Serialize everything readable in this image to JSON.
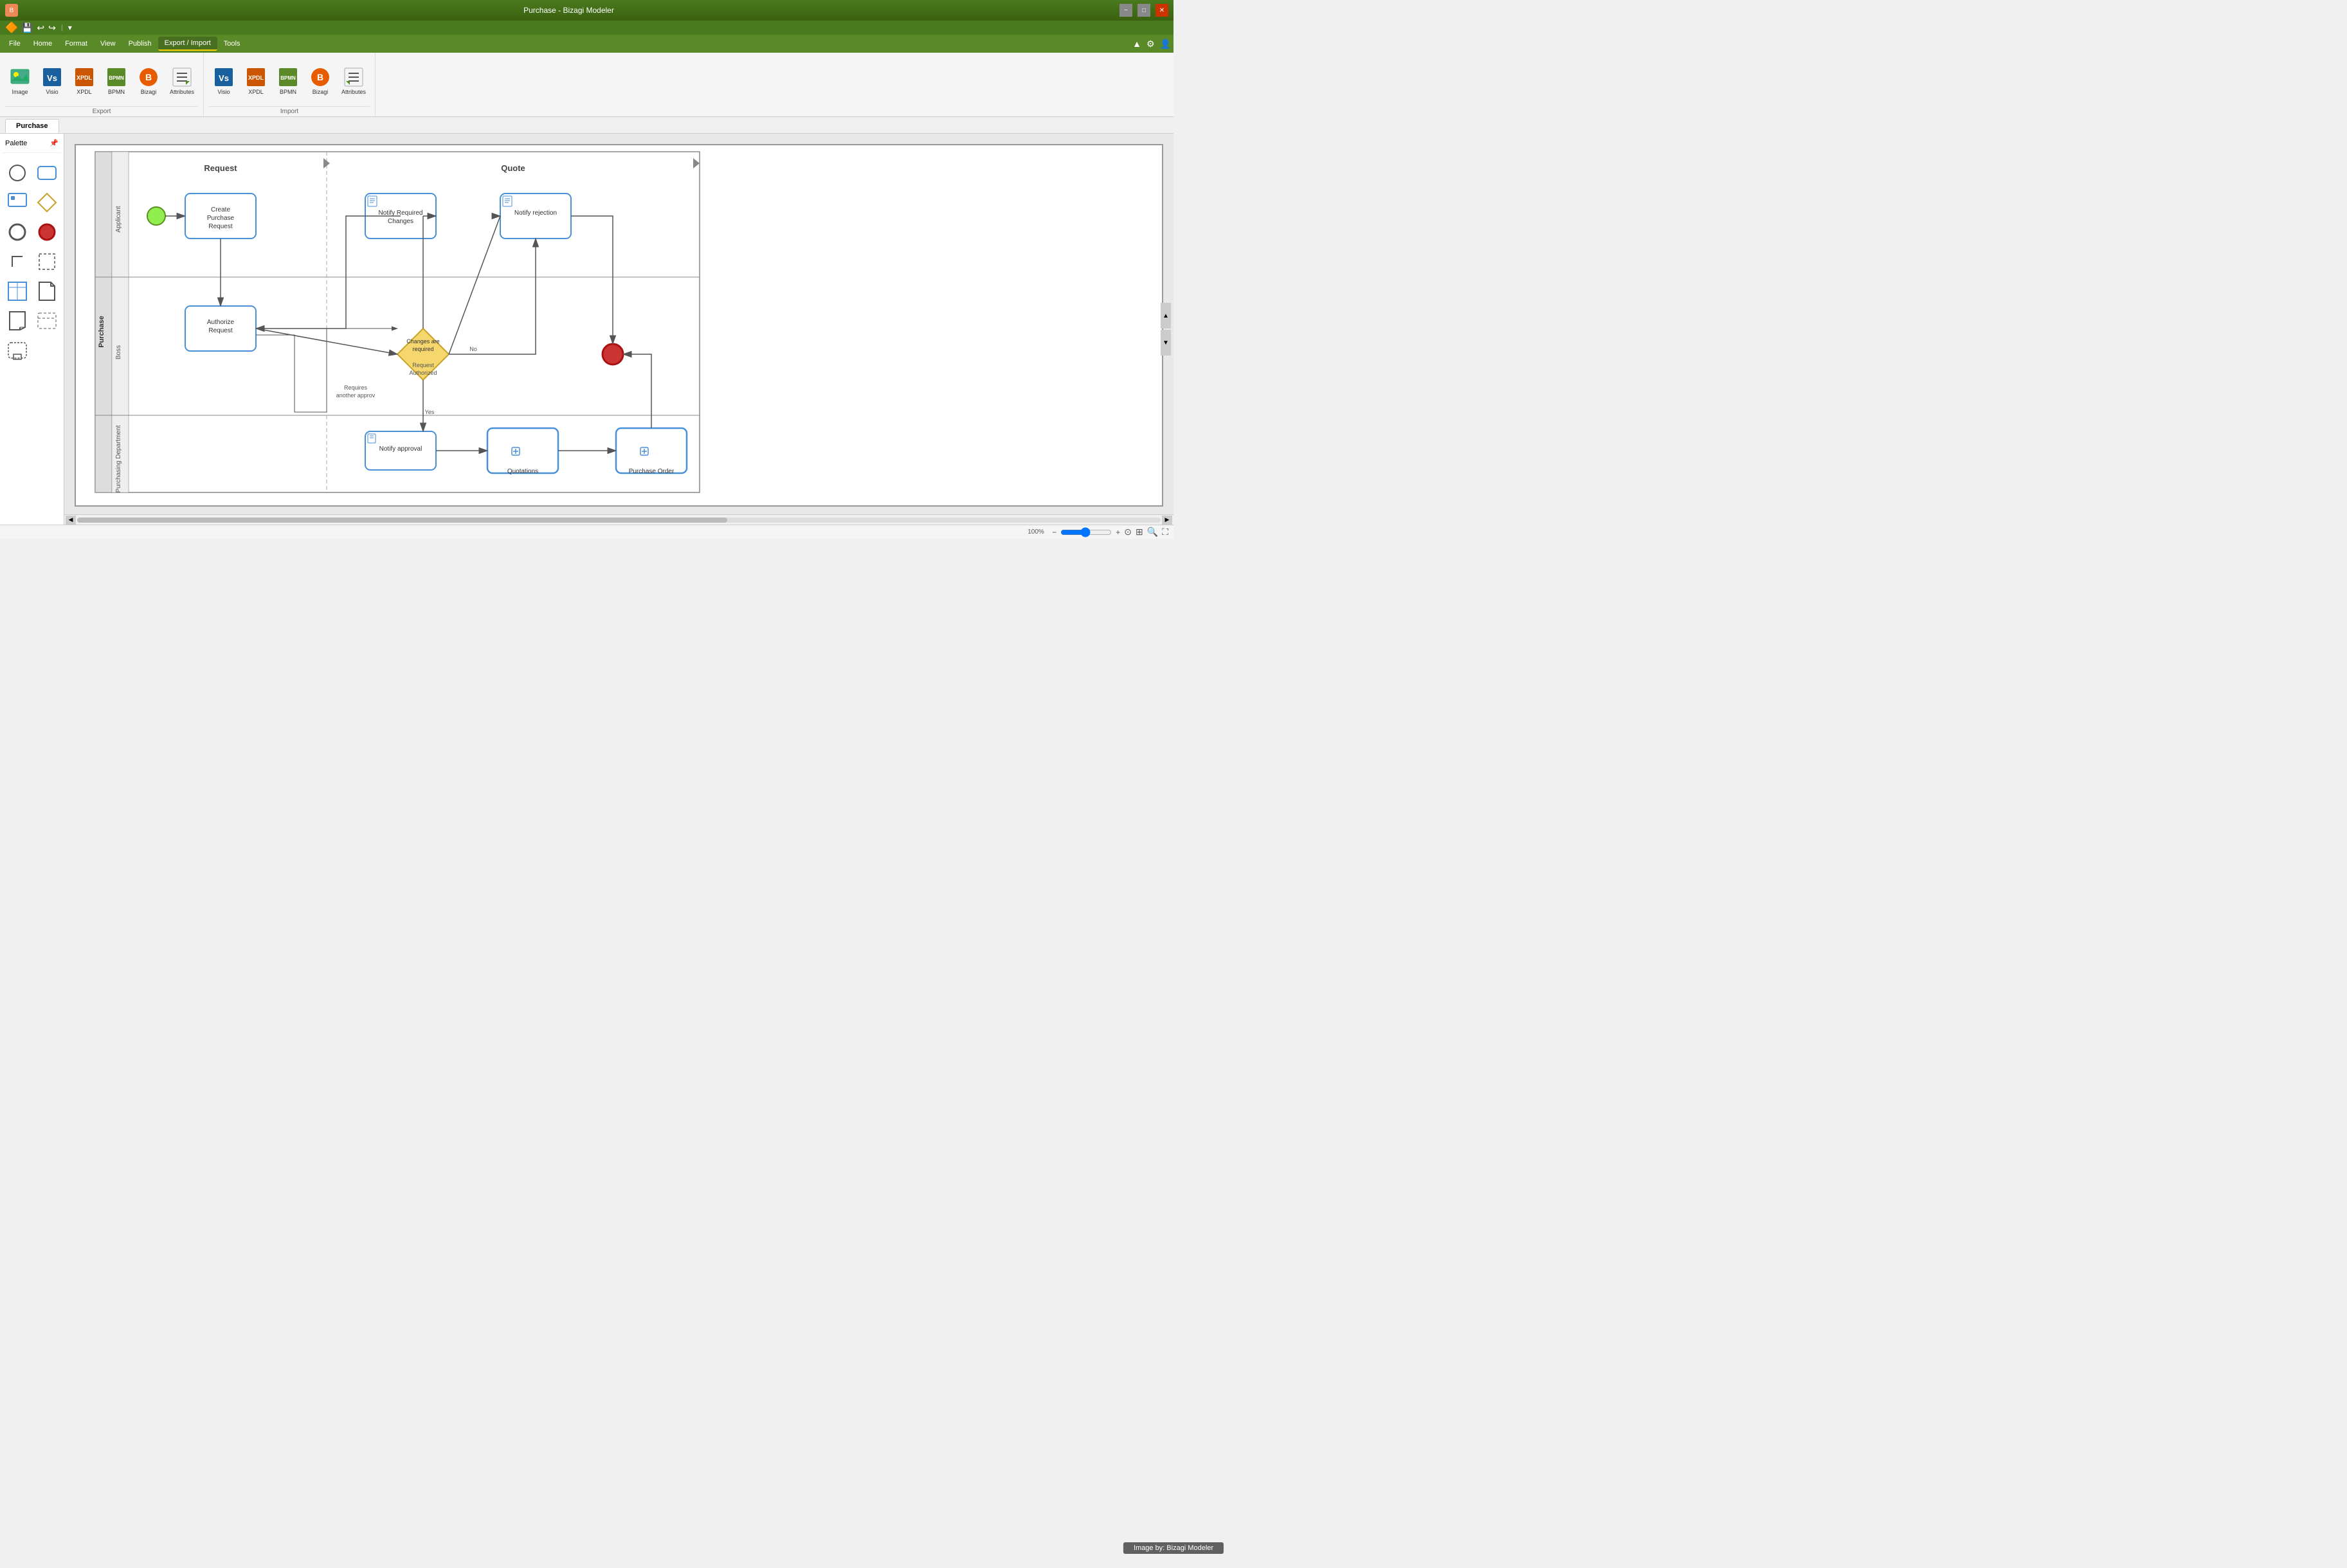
{
  "app": {
    "title": "Purchase - Bizagi Modeler",
    "icon": "B"
  },
  "window_controls": {
    "minimize": "−",
    "maximize": "□",
    "close": "✕"
  },
  "quick_access": {
    "save": "💾",
    "undo": "↩",
    "redo": "↪",
    "more": "▾"
  },
  "menu": {
    "items": [
      "File",
      "Home",
      "Format",
      "View",
      "Publish",
      "Export / Import",
      "Tools"
    ],
    "active": "Export / Import",
    "right": [
      "▲",
      "⚙",
      "👤"
    ]
  },
  "toolbar": {
    "export_section": {
      "label": "Export",
      "buttons": [
        {
          "id": "export-image",
          "label": "Image"
        },
        {
          "id": "export-visio",
          "label": "Visio"
        },
        {
          "id": "export-xpdl",
          "label": "XPDL"
        },
        {
          "id": "export-bpmn",
          "label": "BPMN"
        },
        {
          "id": "export-bizagi",
          "label": "Bizagi"
        },
        {
          "id": "export-attributes",
          "label": "Attributes"
        }
      ]
    },
    "import_section": {
      "label": "Import",
      "buttons": [
        {
          "id": "import-visio",
          "label": "Visio"
        },
        {
          "id": "import-xpdl",
          "label": "XPDL"
        },
        {
          "id": "import-bpmn",
          "label": "BPMN"
        },
        {
          "id": "import-bizagi",
          "label": "Bizagi"
        },
        {
          "id": "import-attributes",
          "label": "Attributes"
        }
      ]
    }
  },
  "palette": {
    "title": "Palette",
    "items": [
      {
        "id": "circle-empty",
        "shape": "circle-empty"
      },
      {
        "id": "rect-rounded",
        "shape": "rect-rounded"
      },
      {
        "id": "rect-callout",
        "shape": "rect-callout"
      },
      {
        "id": "diamond",
        "shape": "diamond"
      },
      {
        "id": "circle-thick",
        "shape": "circle-thick"
      },
      {
        "id": "circle-red",
        "shape": "circle-red"
      },
      {
        "id": "corner-connector",
        "shape": "corner"
      },
      {
        "id": "dashed-rect",
        "shape": "dashed-rect"
      },
      {
        "id": "table",
        "shape": "table"
      },
      {
        "id": "document",
        "shape": "document"
      },
      {
        "id": "note",
        "shape": "note"
      },
      {
        "id": "dashed-box",
        "shape": "dashed-box"
      },
      {
        "id": "subprocess",
        "shape": "subprocess"
      }
    ]
  },
  "tabs": [
    {
      "id": "purchase-tab",
      "label": "Purchase",
      "active": true
    }
  ],
  "diagram": {
    "title": "Purchase",
    "pools": [
      {
        "id": "purchase-pool",
        "label": "Purchase",
        "lanes": [
          {
            "id": "applicant-lane",
            "label": "Applicant"
          },
          {
            "id": "boss-lane",
            "label": "Boss"
          },
          {
            "id": "purchasing-lane",
            "label": "Purchasing Department"
          }
        ]
      }
    ],
    "sections": [
      {
        "id": "request-section",
        "label": "Request"
      },
      {
        "id": "quote-section",
        "label": "Quote"
      }
    ],
    "nodes": [
      {
        "id": "start",
        "type": "start-event",
        "label": ""
      },
      {
        "id": "create-purchase",
        "type": "task",
        "label": "Create Purchase Request"
      },
      {
        "id": "notify-changes",
        "type": "task",
        "label": "Notify Required Changes"
      },
      {
        "id": "notify-rejection",
        "type": "task",
        "label": "Notify rejection"
      },
      {
        "id": "authorize-request",
        "type": "task",
        "label": "Authorize Request"
      },
      {
        "id": "changes-gateway",
        "type": "gateway",
        "label": "Changes are required"
      },
      {
        "id": "request-authorized-label",
        "type": "label",
        "label": "Request Authorized"
      },
      {
        "id": "notify-approval",
        "type": "task",
        "label": "Notify approval"
      },
      {
        "id": "quotations",
        "type": "task",
        "label": "Quotations"
      },
      {
        "id": "purchase-order",
        "type": "task",
        "label": "Purchase Order"
      },
      {
        "id": "end-event",
        "type": "end-event",
        "label": ""
      }
    ],
    "connections": [
      {
        "from": "start",
        "to": "create-purchase"
      },
      {
        "from": "create-purchase",
        "to": "authorize-request"
      },
      {
        "from": "authorize-request",
        "to": "changes-gateway"
      },
      {
        "from": "changes-gateway",
        "to": "notify-changes",
        "label": ""
      },
      {
        "from": "changes-gateway",
        "to": "notify-approval",
        "label": "Yes"
      },
      {
        "from": "changes-gateway",
        "to": "notify-rejection",
        "label": "No"
      },
      {
        "from": "notify-changes",
        "to": "authorize-request"
      },
      {
        "from": "notify-approval",
        "to": "quotations"
      },
      {
        "from": "quotations",
        "to": "purchase-order"
      },
      {
        "from": "purchase-order",
        "to": "end-event"
      }
    ],
    "labels": {
      "requires_another": "Requires another approv",
      "yes": "Yes",
      "no": "No",
      "request_authorized": "Request Authorized"
    }
  },
  "statusbar": {
    "zoom_label": "100%",
    "footer_text": "Image by: Bizagi Modeler",
    "nav_left": "‹",
    "nav_right": "›",
    "icons": [
      "circle-icon",
      "grid-icon",
      "search-icon",
      "layout-icon"
    ]
  }
}
